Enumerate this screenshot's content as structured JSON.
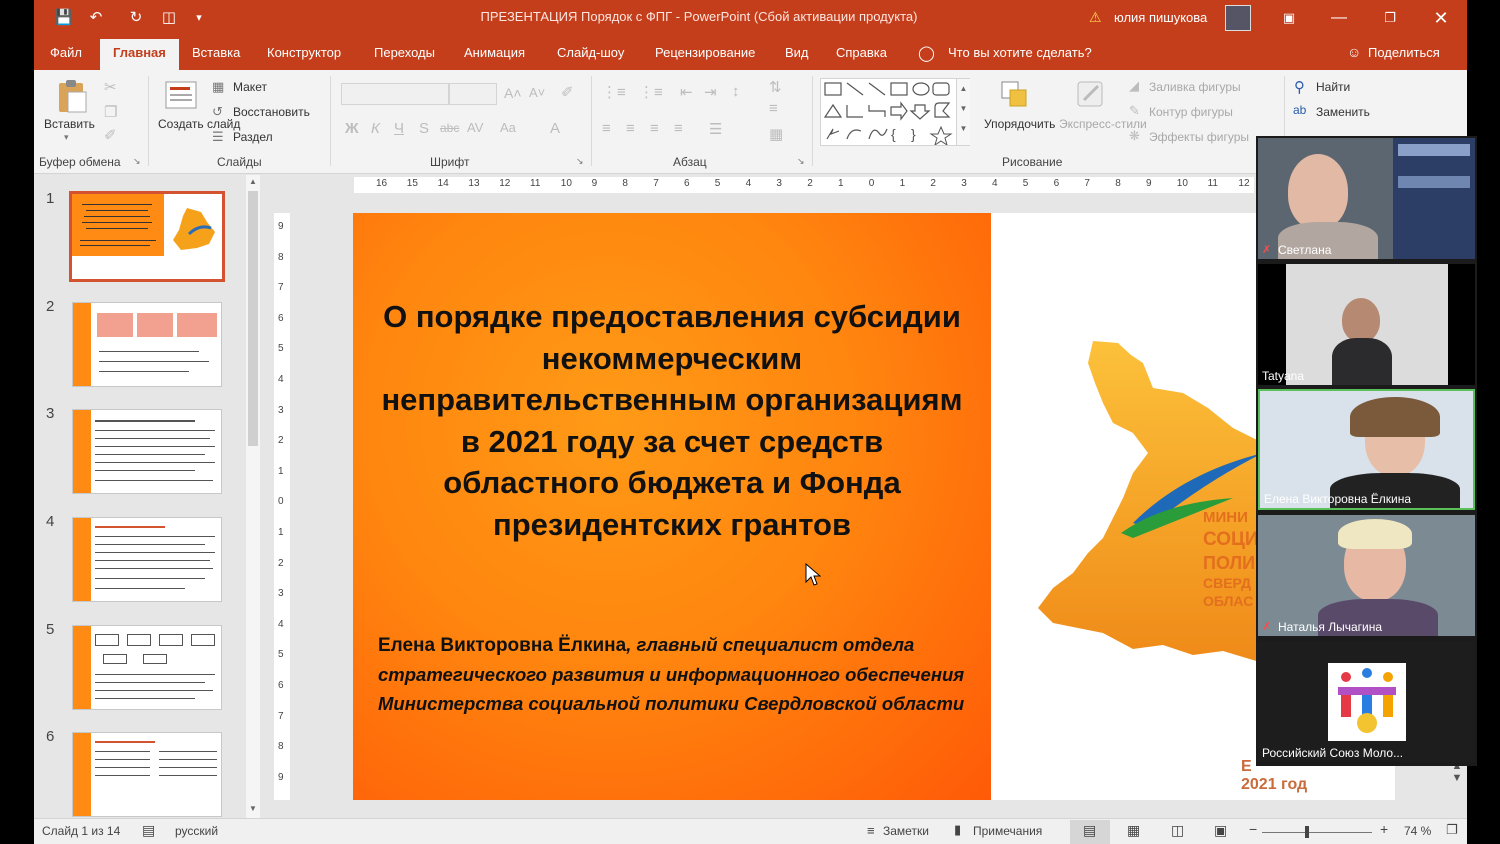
{
  "titlebar": {
    "doc_title": "ПРЕЗЕНТАЦИЯ Порядок с ФПГ  -  PowerPoint (Сбой активации продукта)",
    "user_name": "юлия пишукова"
  },
  "menu": {
    "tabs": [
      "Файл",
      "Главная",
      "Вставка",
      "Конструктор",
      "Переходы",
      "Анимация",
      "Слайд-шоу",
      "Рецензирование",
      "Вид",
      "Справка"
    ],
    "active_tab": "Главная",
    "tell_me": "Что вы хотите сделать?",
    "share": "Поделиться"
  },
  "ribbon": {
    "clipboard": {
      "paste": "Вставить",
      "group": "Буфер обмена"
    },
    "slides": {
      "new_slide": "Создать слайд",
      "layout": "Макет",
      "reset": "Восстановить",
      "section": "Раздел",
      "group": "Слайды"
    },
    "font": {
      "group": "Шрифт"
    },
    "paragraph": {
      "group": "Абзац"
    },
    "drawing": {
      "arrange": "Упорядочить",
      "quick_styles": "Экспресс-стили",
      "shape_fill": "Заливка фигуры",
      "shape_outline": "Контур фигуры",
      "shape_effects": "Эффекты фигуры",
      "group": "Рисование"
    },
    "editing": {
      "find": "Найти",
      "replace": "Заменить"
    }
  },
  "thumbnails": [
    {
      "num": "1",
      "selected": true
    },
    {
      "num": "2"
    },
    {
      "num": "3"
    },
    {
      "num": "4"
    },
    {
      "num": "5"
    },
    {
      "num": "6"
    }
  ],
  "ruler": {
    "horizontal": [
      "16",
      "15",
      "14",
      "13",
      "12",
      "11",
      "10",
      "9",
      "8",
      "7",
      "6",
      "5",
      "4",
      "3",
      "2",
      "1",
      "0",
      "1",
      "2",
      "3",
      "4",
      "5",
      "6",
      "7",
      "8",
      "9",
      "10",
      "11",
      "12"
    ],
    "vertical": [
      "9",
      "8",
      "7",
      "6",
      "5",
      "4",
      "3",
      "2",
      "1",
      "0",
      "1",
      "2",
      "3",
      "4",
      "5",
      "6",
      "7",
      "8",
      "9"
    ]
  },
  "slide": {
    "title": "О порядке предоставления субсидии некоммерческим неправительственным организациям в 2021 году за счет средств областного бюджета и Фонда президентских грантов",
    "author_name": "Елена Викторовна Ёлкина",
    "author_role": ", главный специалист отдела стратегического развития и информационного обеспечения Министерства социальной политики Свердловской области",
    "logo_lines": [
      "МИНИ",
      "СОЦИ",
      "ПОЛИ",
      "СВЕРД",
      "ОБЛАС"
    ],
    "year_lines": [
      "Е",
      "2021 год"
    ],
    "colors": {
      "orange": "#ff860f",
      "logo_orange": "#e36f1e",
      "blue": "#1e6ab8",
      "green": "#2a9d3a"
    }
  },
  "statusbar": {
    "slide_counter": "Слайд 1 из 14",
    "language": "русский",
    "notes": "Заметки",
    "comments": "Примечания",
    "zoom": "74 %"
  },
  "participants": [
    {
      "name": "Светлана",
      "muted": true
    },
    {
      "name": "Tatyana",
      "muted": false
    },
    {
      "name": "Елена Викторовна Ёлкина",
      "muted": false,
      "speaking": true
    },
    {
      "name": "Наталья Лычагина",
      "muted": true
    },
    {
      "name": "Российский Союз Моло...",
      "muted": false
    }
  ]
}
